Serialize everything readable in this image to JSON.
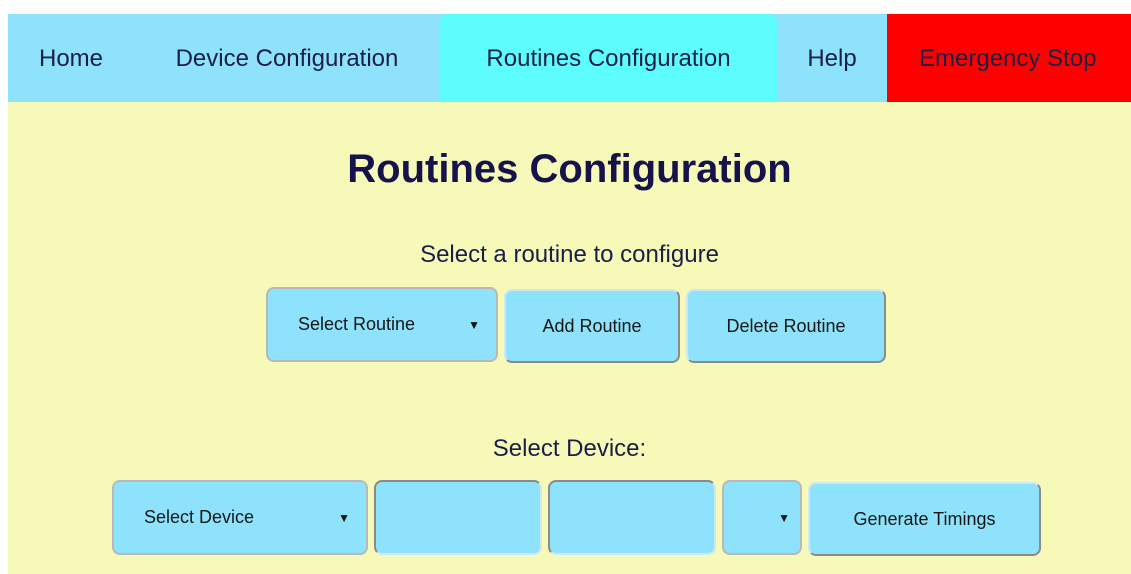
{
  "nav": {
    "home": "Home",
    "device_configuration": "Device Configuration",
    "routines_configuration": "Routines Configuration",
    "help": "Help",
    "emergency_stop": "Emergency Stop"
  },
  "main": {
    "title": "Routines Configuration",
    "subtitle": "Select a routine to configure",
    "routine_select": "Select Routine",
    "add_routine": "Add Routine",
    "delete_routine": "Delete Routine",
    "device_label": "Select Device:",
    "device_select": "Select Device",
    "input_1_value": "",
    "input_2_value": "",
    "small_select": "",
    "generate_timings": "Generate Timings"
  },
  "icons": {
    "dropdown": "caret-down-icon"
  },
  "colors": {
    "page_background": "#f6f9b8",
    "navbar_background": "#8fe2fb",
    "active_tab": "#5dfdfe",
    "emergency_stop": "#ff0000",
    "control_background": "#8fe2fb",
    "title_text": "#15134a"
  }
}
